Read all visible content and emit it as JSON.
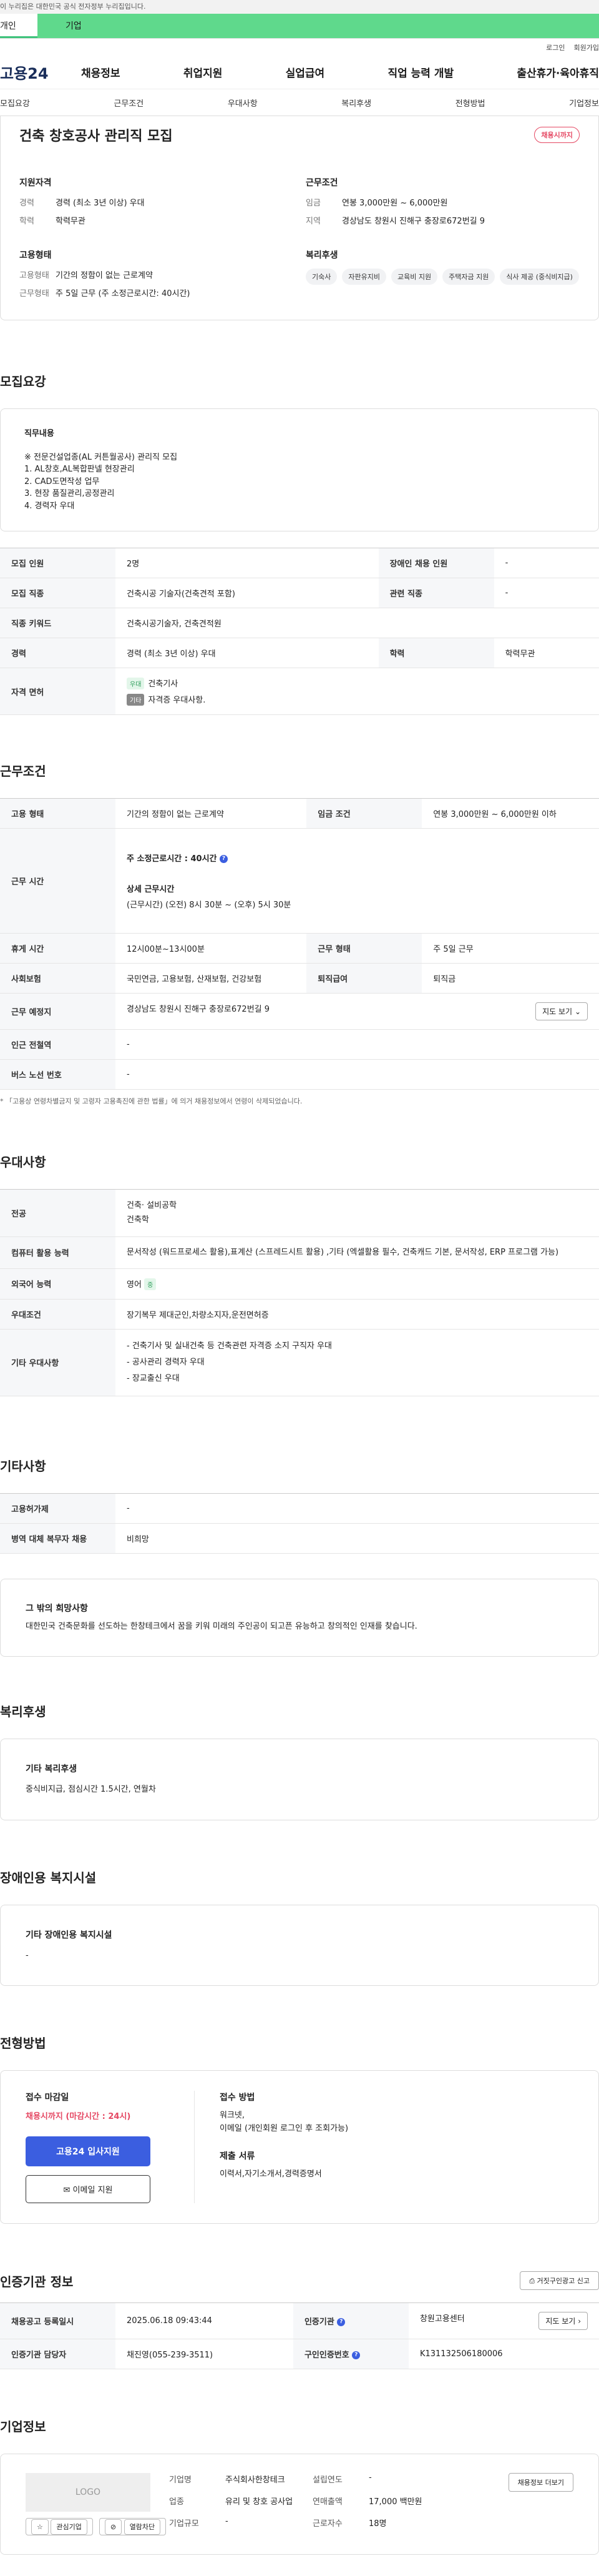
{
  "topbar": {
    "notice": "이 누리집은 대한민국 공식 전자정부 누리집입니다."
  },
  "typebar": {
    "tab1": "개인",
    "tab2": "기업"
  },
  "util": {
    "login": "로그인",
    "join": "회원가입"
  },
  "gnb": {
    "logo": "고용24",
    "menu": [
      "채용정보",
      "취업지원",
      "실업급여",
      "직업 능력 개발",
      "출산휴가·육아휴직"
    ]
  },
  "anchors": [
    "모집요강",
    "근무조건",
    "우대사항",
    "복리후생",
    "전형방법",
    "기업정보"
  ],
  "summary": {
    "title": "건축 창호공사 관리직 모집",
    "badge": "채용시까지",
    "qual_title": "지원자격",
    "qual": [
      {
        "k": "경력",
        "v": "경력 (최소 3년 이상) 우대"
      },
      {
        "k": "학력",
        "v": "학력무관"
      }
    ],
    "cond_title": "근무조건",
    "cond": [
      {
        "k": "임금",
        "v": "연봉 3,000만원 ~ 6,000만원"
      },
      {
        "k": "지역",
        "v": "경상남도 창원시 진해구 충장로672번길 9"
      }
    ],
    "emp_title": "고용형태",
    "emp": [
      {
        "k": "고용형태",
        "v": "기간의 정함이 없는 근로계약"
      },
      {
        "k": "근무형태",
        "v": "주 5일 근무 (주 소정근로시간: 40시간)"
      }
    ],
    "welfare_title": "복리후생",
    "welfare_tags": [
      "기숙사",
      "자판유지비",
      "교육비 지원",
      "주택자금 지원",
      "식사 제공 (중식비지급)"
    ]
  },
  "recruit": {
    "section_title": "모집요강",
    "duty_title": "직무내용",
    "duty_lines": [
      "※ 전문건설업종(AL 커튼월공사) 관리직 모집",
      "1. AL창호,AL복합판넬 현장관리",
      "2. CAD도면작성 업무",
      "3. 현장 품질관리,공정관리",
      "4. 경력자 우대"
    ],
    "rows": {
      "count_h": "모집 인원",
      "count": "2명",
      "disabled_h": "장애인 채용 인원",
      "disabled": "-",
      "job_h": "모집 직종",
      "job": "건축시공 기술자(건축견적 포함)",
      "related_h": "관련 직종",
      "related": "-",
      "kw_h": "직종 키워드",
      "kw": "건축시공기술자, 건축견적원",
      "career_h": "경력",
      "career": "경력 (최소 3년 이상) 우대",
      "edu_h": "학력",
      "edu": "학력무관",
      "license_h": "자격 면허",
      "lic1_tag": "우대",
      "lic1": "건축기사",
      "lic2_tag": "기타",
      "lic2": "자격증 우대사항."
    }
  },
  "work": {
    "section_title": "근무조건",
    "emp_h": "고용 형태",
    "emp": "기간의 정함이 없는 근로계약",
    "wage_h": "임금 조건",
    "wage": "연봉 3,000만원 ~ 6,000만원 이하",
    "time_h": "근무 시간",
    "time_main": "주 소정근로시간 : 40시간",
    "time_detail_h": "상세 근무시간",
    "time_detail": "(근무시간) (오전) 8시 30분 ~ (오후) 5시 30분",
    "rest_h": "휴게 시간",
    "rest": "12시00분~13시00분",
    "form_h": "근무 형태",
    "form": "주 5일 근무",
    "ins_h": "사회보험",
    "ins": "국민연금, 고용보험, 산재보험, 건강보험",
    "retire_h": "퇴직급여",
    "retire": "퇴직금",
    "place_h": "근무 예정지",
    "place": "경상남도 창원시 진해구 충장로672번길 9",
    "map_btn": "지도 보기",
    "subway_h": "인근 전철역",
    "subway": "-",
    "bus_h": "버스 노선 번호",
    "bus": "-",
    "note": "* 「고용상 연령차별금지 및 고령자 고용촉진에 관한 법률」에 의거 채용정보에서 연령이 삭제되었습니다."
  },
  "pref": {
    "section_title": "우대사항",
    "major_h": "전공",
    "major1": "건축· 설비공학",
    "major2": "건축학",
    "pc_h": "컴퓨터 활용 능력",
    "pc": "문서작성 (워드프로세스 활용),표계산 (스프레드시트 활용) ,기타 (엑셀활용 필수, 건축캐드 기본, 문서작성, ERP 프로그램 가능)",
    "lang_h": "외국어 능력",
    "lang": "영어",
    "lang_level": "중",
    "cond_h": "우대조건",
    "cond": "장기복무 제대군인,차량소지자,운전면허증",
    "etc_h": "기타 우대사항",
    "etc": [
      "- 건축기사 및 실내건축 등 건축관련 자격증 소지 구직자 우대",
      "- 공사관리 경력자 우대",
      "- 장교출신 우대"
    ]
  },
  "other": {
    "section_title": "기타사항",
    "support_h": "고용허가제",
    "support": "-",
    "military_h": "병역 대체 복무자 채용",
    "military": "비희망",
    "wish_title": "그 밖의 희망사항",
    "wish": "대한민국 건축문화를 선도하는 한창테크에서 꿈을 키워 미래의 주인공이 되고픈 유능하고 창의적인 인재를 찾습니다."
  },
  "welfare": {
    "section_title": "복리후생",
    "etc_title": "기타 복리후생",
    "etc": "중식비지급, 점심시간 1.5시간, 연월차"
  },
  "disabled_fac": {
    "section_title": "장애인용 복지시설",
    "title": "기타 장애인용 복지시설",
    "value": "-"
  },
  "apply": {
    "section_title": "전형방법",
    "deadline_h": "접수 마감일",
    "deadline": "채용시까지 (마감시간 : 24시)",
    "apply_btn": "고용24 입사지원",
    "mail_btn": "이메일 지원",
    "method_h": "접수 방법",
    "method1": "워크넷,",
    "method2": "이메일 (개인회원 로그인 후 조회가능)",
    "docs_h": "제출 서류",
    "docs": "이력서,자기소개서,경력증명서"
  },
  "cert": {
    "section_title": "인증기관 정보",
    "report_btn": "거짓구인광고 신고",
    "reg_h": "채용공고 등록일시",
    "reg": "2025.06.18 09:43:44",
    "org_h": "인증기관",
    "org": "창원고용센터",
    "map_btn": "지도 보기",
    "mgr_h": "인증기관 담당자",
    "mgr": "채진영(055-239-3511)",
    "no_h": "구인인증번호",
    "no": "K131132506180006"
  },
  "company": {
    "section_title": "기업정보",
    "logo": "LOGO",
    "fav_btn": "관심기업",
    "block_btn": "열람차단",
    "name_h": "기업명",
    "name": "주식회사한창테크",
    "est_h": "설립연도",
    "est": "-",
    "ind_h": "업종",
    "ind": "유리 및 창호 공사업",
    "sales_h": "연매출액",
    "sales": "17,000 백만원",
    "emp_h": "근로자수",
    "emp": "18명",
    "scale_h": "기업규모",
    "scale": "-",
    "jobs_btn": "채용정보 더보기"
  }
}
